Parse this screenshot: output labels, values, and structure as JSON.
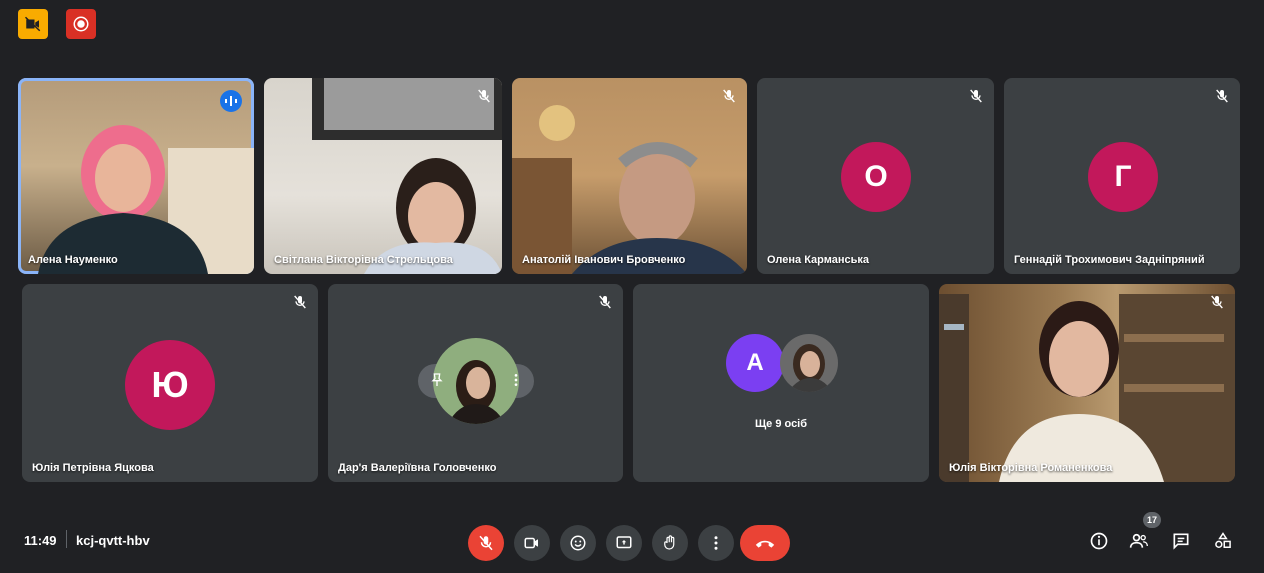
{
  "top_badges": [
    {
      "icon": "camera-off-icon",
      "color": "#f9ab00"
    },
    {
      "icon": "record-icon",
      "color": "#d93025"
    }
  ],
  "tiles": [
    {
      "name": "Алена Науменко",
      "type": "video",
      "speaking": true
    },
    {
      "name": "Світлана Вікторівна Стрельцова",
      "type": "video"
    },
    {
      "name": "Анатолій Іванович Бровченко",
      "type": "video"
    },
    {
      "name": "Олена Карманська",
      "type": "avatar",
      "initial": "О",
      "color": "#c2185b"
    },
    {
      "name": "Геннадій Трохимович Задніпряний",
      "type": "avatar",
      "initial": "Г",
      "color": "#c2185b"
    },
    {
      "name": "Юлія Петрівна Яцкова",
      "type": "avatar",
      "initial": "Ю",
      "color": "#c2185b"
    },
    {
      "name": "Дар'я Валеріївна Головченко",
      "type": "photo-avatar"
    },
    {
      "name": "Ще 9 осіб",
      "type": "group",
      "initial": "А",
      "color": "#7b3ff2"
    },
    {
      "name": "Юлія Вікторівна Романенкова",
      "type": "video"
    }
  ],
  "controls": {
    "time": "11:49",
    "meeting_code": "kcj-qvtt-hbv",
    "participant_count": "17",
    "buttons": [
      "mic-off-icon",
      "camera-icon",
      "emoji-icon",
      "present-icon",
      "raise-hand-icon",
      "more-icon",
      "end-call-icon"
    ],
    "right_buttons": [
      "info-icon",
      "people-icon",
      "chat-icon",
      "activities-icon"
    ]
  },
  "colors": {
    "background": "#202124",
    "tile": "#3c4043",
    "accent": "#8ab4f8",
    "end_call": "#ea4335"
  }
}
